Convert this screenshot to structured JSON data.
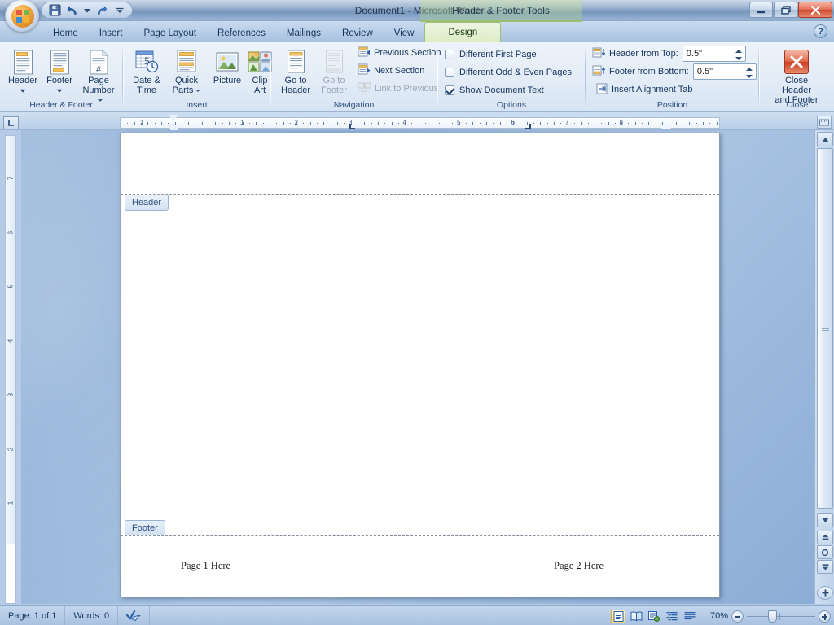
{
  "window": {
    "title": "Document1 - Microsoft Word",
    "contextual_title": "Header & Footer Tools",
    "minimize_label": "Minimize",
    "restore_label": "Restore",
    "close_label": "Close",
    "help_label": "?"
  },
  "quick_access": {
    "items": [
      {
        "name": "office-button",
        "label": "Office Button"
      },
      {
        "name": "save-icon",
        "label": "Save"
      },
      {
        "name": "undo-icon",
        "label": "Undo"
      },
      {
        "name": "undo-dropdown-icon",
        "label": "Undo options"
      },
      {
        "name": "redo-icon",
        "label": "Redo"
      },
      {
        "name": "customize-qat-icon",
        "label": "Customize Quick Access Toolbar"
      }
    ]
  },
  "ribbon": {
    "tabs": [
      {
        "label": "Home",
        "active": false
      },
      {
        "label": "Insert",
        "active": false
      },
      {
        "label": "Page Layout",
        "active": false
      },
      {
        "label": "References",
        "active": false
      },
      {
        "label": "Mailings",
        "active": false
      },
      {
        "label": "Review",
        "active": false
      },
      {
        "label": "View",
        "active": false
      },
      {
        "label": "Design",
        "active": true
      }
    ],
    "groups": {
      "header_footer": {
        "label": "Header & Footer",
        "buttons": [
          {
            "label": "Header",
            "icon": "header-icon",
            "has_dropdown": true
          },
          {
            "label": "Footer",
            "icon": "footer-icon",
            "has_dropdown": true
          },
          {
            "label": "Page Number",
            "icon": "page-number-icon",
            "has_dropdown": true
          }
        ]
      },
      "insert": {
        "label": "Insert",
        "buttons": [
          {
            "label": "Date & Time",
            "icon": "date-time-icon",
            "has_dropdown": false
          },
          {
            "label": "Quick Parts",
            "icon": "quick-parts-icon",
            "has_dropdown": true
          },
          {
            "label": "Picture",
            "icon": "picture-icon",
            "has_dropdown": false
          },
          {
            "label": "Clip Art",
            "icon": "clip-art-icon",
            "has_dropdown": false
          }
        ]
      },
      "navigation": {
        "label": "Navigation",
        "big_buttons": [
          {
            "label": "Go to Header",
            "icon": "go-to-header-icon",
            "enabled": true
          },
          {
            "label": "Go to Footer",
            "icon": "go-to-footer-icon",
            "enabled": false
          }
        ],
        "small_buttons": [
          {
            "label": "Previous Section",
            "icon": "previous-section-icon",
            "enabled": true
          },
          {
            "label": "Next Section",
            "icon": "next-section-icon",
            "enabled": true
          },
          {
            "label": "Link to Previous",
            "icon": "link-to-previous-icon",
            "enabled": false
          }
        ]
      },
      "options": {
        "label": "Options",
        "checkboxes": [
          {
            "label": "Different First Page",
            "checked": false
          },
          {
            "label": "Different Odd & Even Pages",
            "checked": false
          },
          {
            "label": "Show Document Text",
            "checked": true
          }
        ]
      },
      "position": {
        "label": "Position",
        "header_from_top": {
          "label": "Header from Top:",
          "value": "0.5\"",
          "icon": "header-from-top-icon"
        },
        "footer_from_bottom": {
          "label": "Footer from Bottom:",
          "value": "0.5\"",
          "icon": "footer-from-bottom-icon"
        },
        "insert_alignment_tab": {
          "label": "Insert Alignment Tab",
          "icon": "alignment-tab-icon"
        }
      },
      "close": {
        "label": "Close",
        "button": {
          "label": "Close Header and Footer",
          "line1": "Close Header",
          "line2": "and Footer",
          "icon": "close-x-icon"
        }
      }
    }
  },
  "rulers": {
    "tab_selector": {
      "name": "tab-selector",
      "type": "left-tab"
    },
    "horizontal": {
      "numbers": [
        "1",
        "1",
        "2",
        "3",
        "4",
        "5",
        "6",
        "7",
        "8"
      ],
      "tab_stops": [
        {
          "type": "left",
          "label": "center-tab-stop"
        },
        {
          "type": "right",
          "label": "right-tab-stop"
        }
      ]
    },
    "vertical": {
      "numbers": [
        "7",
        "6",
        "5",
        "4",
        "3",
        "2",
        "1"
      ]
    }
  },
  "document": {
    "header_tab_label": "Header",
    "footer_tab_label": "Footer",
    "footer_text_left": "Page 1 Here",
    "footer_text_right": "Page 2 Here"
  },
  "status_bar": {
    "page": "Page: 1 of 1",
    "words": "Words: 0",
    "proofing_icon": "proofing-errors-icon",
    "zoom_level": "70%",
    "views": [
      {
        "name": "print-layout-view",
        "label": "Print Layout",
        "active": true
      },
      {
        "name": "full-screen-reading-view",
        "label": "Full Screen Reading",
        "active": false
      },
      {
        "name": "web-layout-view",
        "label": "Web Layout",
        "active": false
      },
      {
        "name": "outline-view",
        "label": "Outline",
        "active": false
      },
      {
        "name": "draft-view",
        "label": "Draft",
        "active": false
      }
    ],
    "zoom_out_label": "Zoom Out",
    "zoom_in_label": "Zoom In"
  },
  "colors": {
    "accent": "#16335c",
    "contextual_tab": "#9cc06f",
    "close_red": "#c93f23",
    "page_white": "#ffffff"
  }
}
